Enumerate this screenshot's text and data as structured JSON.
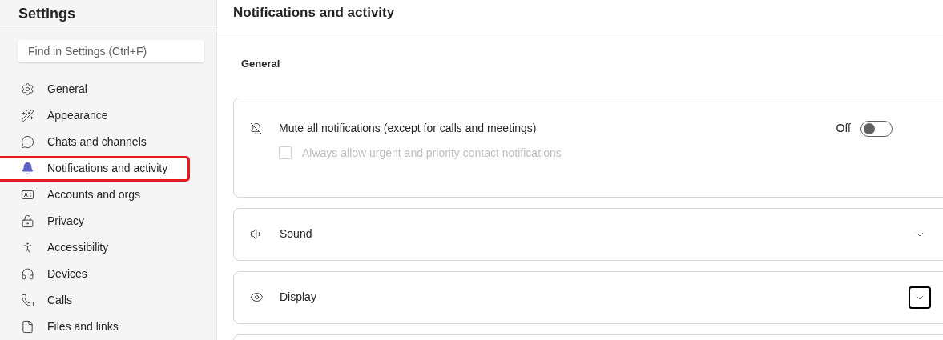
{
  "sidebar": {
    "title": "Settings",
    "search": {
      "placeholder": "Find in Settings (Ctrl+F)"
    },
    "items": [
      {
        "label": "General",
        "selected": false,
        "highlighted": false
      },
      {
        "label": "Appearance",
        "selected": false,
        "highlighted": false
      },
      {
        "label": "Chats and channels",
        "selected": false,
        "highlighted": false
      },
      {
        "label": "Notifications and activity",
        "selected": true,
        "highlighted": true
      },
      {
        "label": "Accounts and orgs",
        "selected": false,
        "highlighted": false
      },
      {
        "label": "Privacy",
        "selected": false,
        "highlighted": false
      },
      {
        "label": "Accessibility",
        "selected": false,
        "highlighted": false
      },
      {
        "label": "Devices",
        "selected": false,
        "highlighted": false
      },
      {
        "label": "Calls",
        "selected": false,
        "highlighted": false
      },
      {
        "label": "Files and links",
        "selected": false,
        "highlighted": false
      }
    ]
  },
  "page": {
    "title": "Notifications and activity",
    "section": "General",
    "mute": {
      "label": "Mute all notifications (except for calls and meetings)",
      "state_label": "Off",
      "on": false,
      "option": {
        "label": "Always allow urgent and priority contact notifications",
        "checked": false,
        "disabled": true
      }
    },
    "panels": [
      {
        "label": "Sound",
        "expanded": false,
        "focused": false
      },
      {
        "label": "Display",
        "expanded": false,
        "focused": true
      }
    ]
  }
}
